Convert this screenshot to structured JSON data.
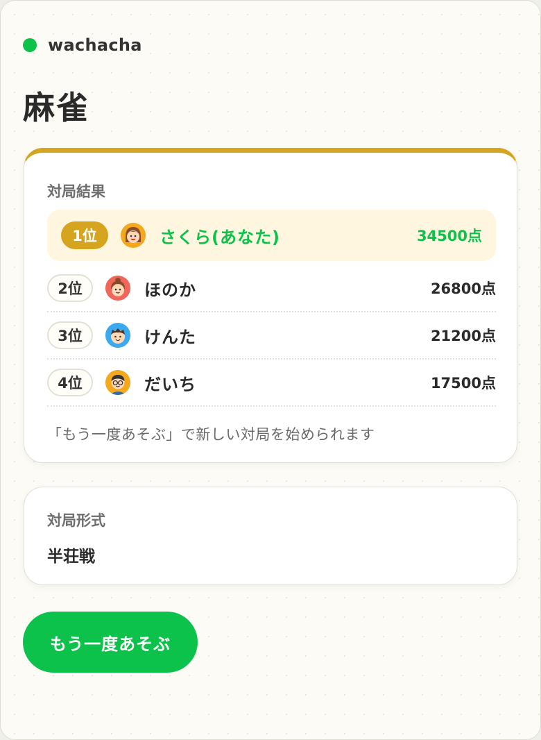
{
  "brand": {
    "name": "wachacha",
    "dot_color": "#0cc24a"
  },
  "page": {
    "title": "麻雀"
  },
  "result": {
    "label": "対局結果",
    "rows": [
      {
        "rank": "1位",
        "name": "さくら(あなた)",
        "score": "34500点",
        "avatar": "girl-avatar-icon",
        "avatar_color": "#f4a81d",
        "is_you": true
      },
      {
        "rank": "2位",
        "name": "ほのか",
        "score": "26800点",
        "avatar": "girl-avatar-icon",
        "avatar_color": "#f0665a",
        "is_you": false
      },
      {
        "rank": "3位",
        "name": "けんた",
        "score": "21200点",
        "avatar": "boy-avatar-icon",
        "avatar_color": "#3aaaf0",
        "is_you": false
      },
      {
        "rank": "4位",
        "name": "だいち",
        "score": "17500点",
        "avatar": "boy-glasses-avatar-icon",
        "avatar_color": "#f4a81d",
        "is_you": false
      }
    ],
    "note": "「もう一度あそぶ」で新しい対局を始められます"
  },
  "format": {
    "label": "対局形式",
    "value": "半荘戦"
  },
  "actions": {
    "replay_label": "もう一度あそぶ"
  },
  "colors": {
    "accent_green": "#0cc24a",
    "gold": "#d6a51f",
    "winner_bg": "#fff6df"
  }
}
